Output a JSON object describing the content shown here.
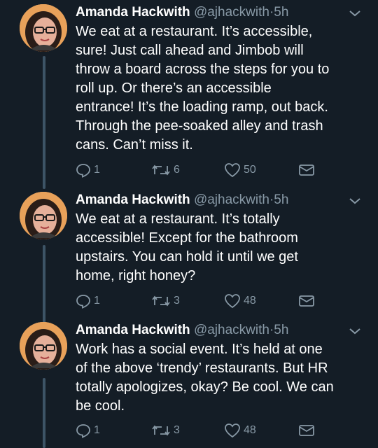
{
  "tweets": [
    {
      "name": "Amanda Hackwith",
      "handle": "@ajhackwith",
      "dot": "·",
      "time": "5h",
      "text": "We eat at a restaurant. It’s accessible,\nsure! Just call ahead and Jimbob will\nthrow a board across the steps for you to\nroll up. Or there’s an accessible\nentrance! It’s the loading ramp, out back.\nThrough the pee-soaked alley and trash\ncans. Can’t miss it.",
      "replies": "1",
      "retweets": "6",
      "likes": "50"
    },
    {
      "name": "Amanda Hackwith",
      "handle": "@ajhackwith",
      "dot": "·",
      "time": "5h",
      "text": "We eat at a restaurant. It’s totally\naccessible! Except for the bathroom\nupstairs. You can hold it until we get\nhome, right honey?",
      "replies": "1",
      "retweets": "3",
      "likes": "48"
    },
    {
      "name": "Amanda Hackwith",
      "handle": "@ajhackwith",
      "dot": "·",
      "time": "5h",
      "text": "Work has a social event. It’s held at one\nof the above ‘trendy’ restaurants. But HR\ntotally apologizes, okay? Be cool. We can\nbe cool.",
      "replies": "1",
      "retweets": "3",
      "likes": "48"
    }
  ],
  "icons": {
    "reply": "reply-icon",
    "retweet": "retweet-icon",
    "like": "heart-icon",
    "dm": "envelope-icon",
    "menu": "chevron-down-icon"
  },
  "colors": {
    "background": "#141d26",
    "secondary_text": "#8899a6",
    "thread_line": "#3d5466"
  }
}
